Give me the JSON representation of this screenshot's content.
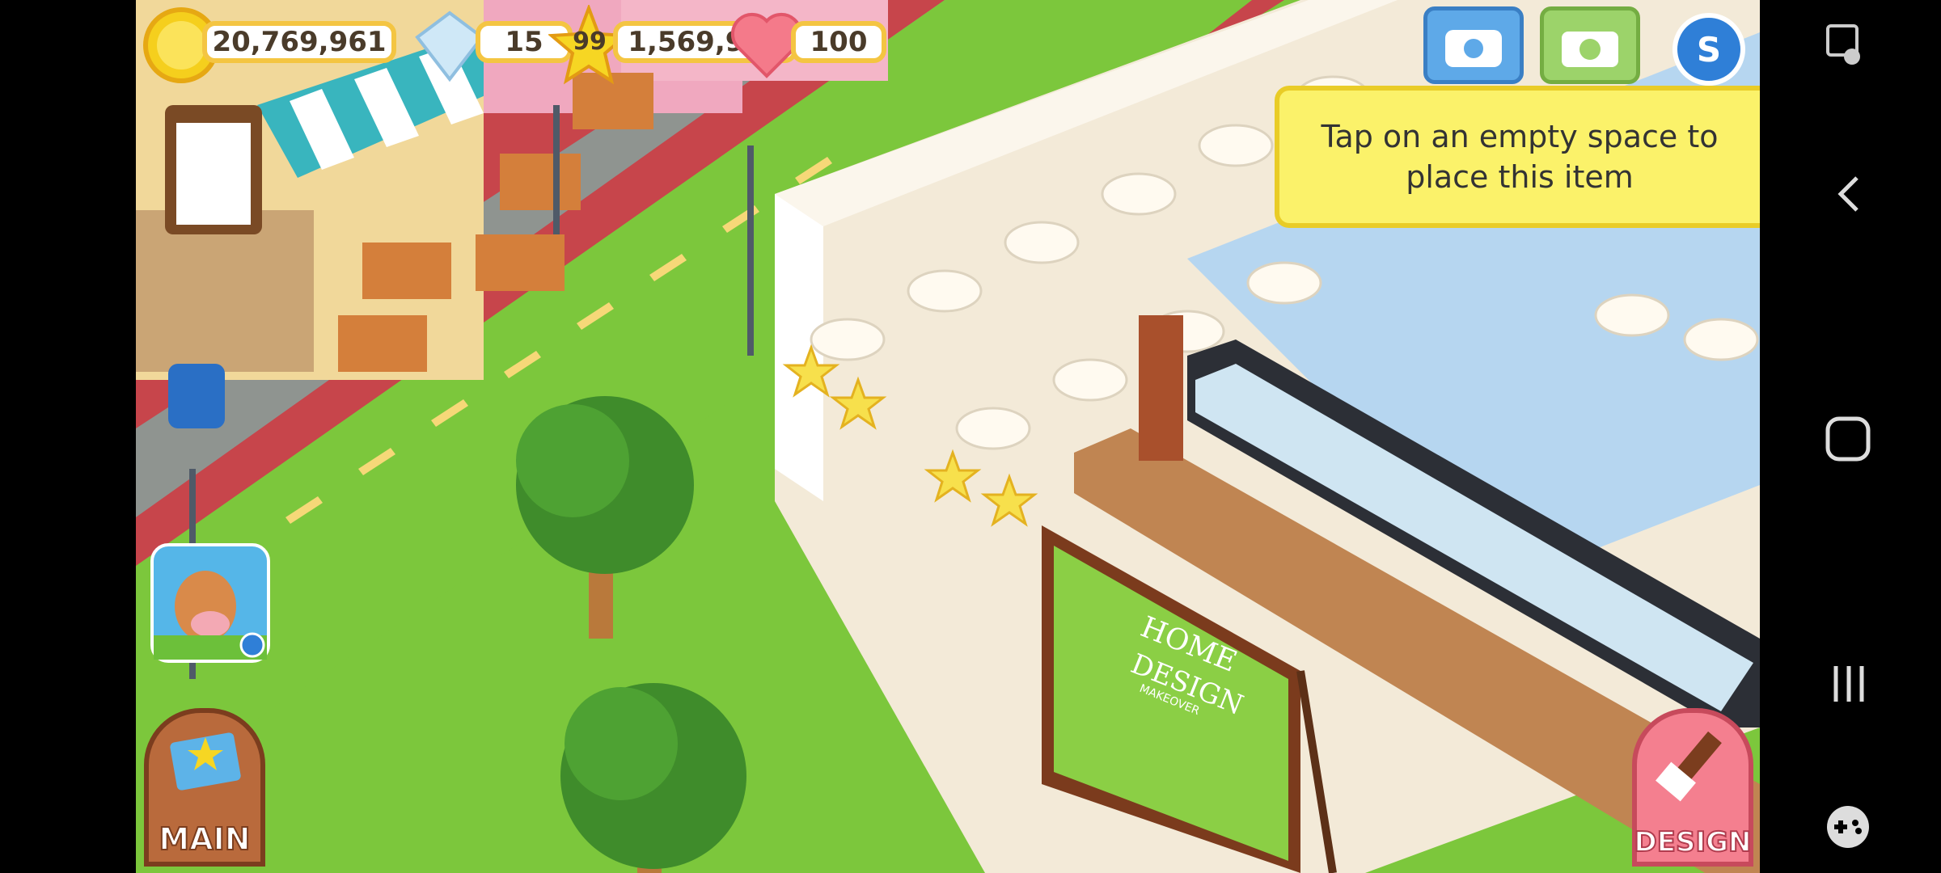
{
  "hud": {
    "coins": "20,769,961",
    "gems": "15",
    "level": "99",
    "xp": "1,569,920",
    "hearts": "100"
  },
  "hint_text": "Tap on an empty space to place this item",
  "buttons": {
    "main_label": "MAIN",
    "design_label": "DESIGN"
  },
  "billboard": {
    "line1": "HOME",
    "line2": "DESIGN",
    "line3": "MAKEOVER"
  },
  "top_icons": [
    "phone-icon",
    "camera-icon",
    "shop-s-icon"
  ],
  "navbar_icons": [
    "screenshot-icon",
    "back-icon",
    "home-icon",
    "recents-icon",
    "game-tools-icon"
  ],
  "colors": {
    "grass": "#7cc73c",
    "road": "#8a8f8a",
    "sidewalk": "#c64a4e",
    "hint_bg": "#fbf26a",
    "pill_border": "#f4c542"
  }
}
